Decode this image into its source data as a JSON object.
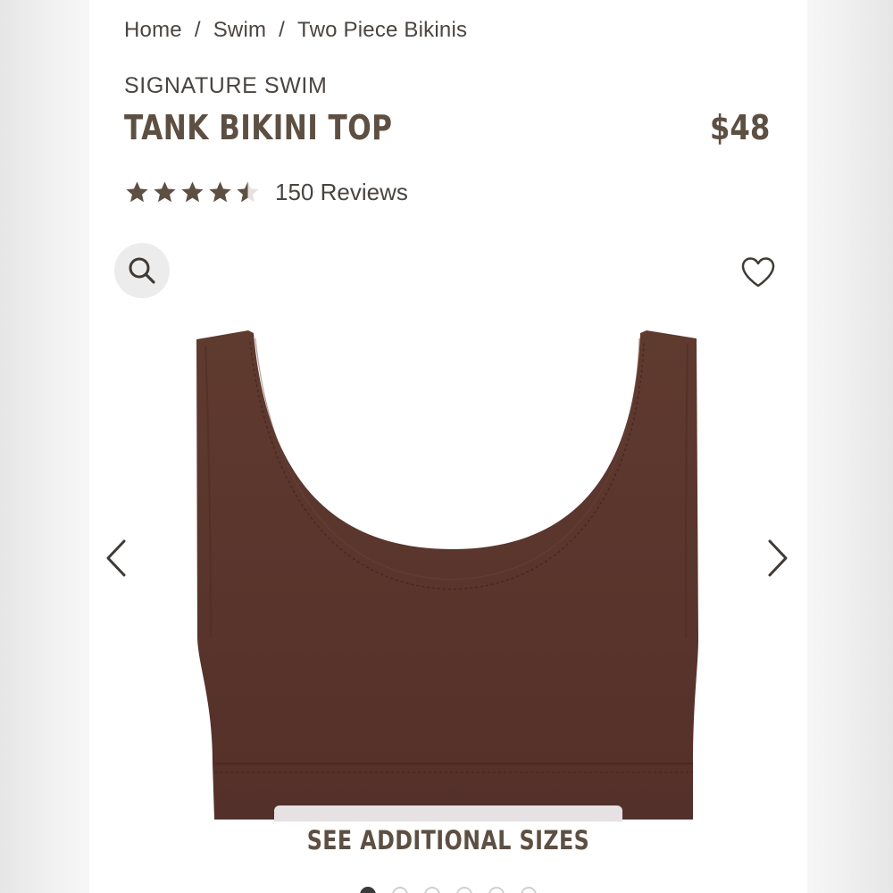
{
  "breadcrumb": {
    "items": [
      "Home",
      "Swim",
      "Two Piece Bikinis"
    ],
    "separator": "/"
  },
  "product": {
    "collection": "SIGNATURE SWIM",
    "title": "TANK BIKINI TOP",
    "price": "$48",
    "rating": 4.5,
    "max_rating": 5,
    "reviews_label": "150 Reviews",
    "image_color": "#5a3328"
  },
  "actions": {
    "zoom_icon": "search-icon",
    "wishlist_icon": "heart-icon",
    "prev_icon": "chevron-left-icon",
    "next_icon": "chevron-right-icon",
    "sizes_label": "SEE ADDITIONAL SIZES"
  },
  "carousel": {
    "slide_count": 6,
    "active_index": 0
  },
  "colors": {
    "brand_text": "#5e4f43",
    "body_text": "#4a4541",
    "star": "#5e4f43"
  }
}
